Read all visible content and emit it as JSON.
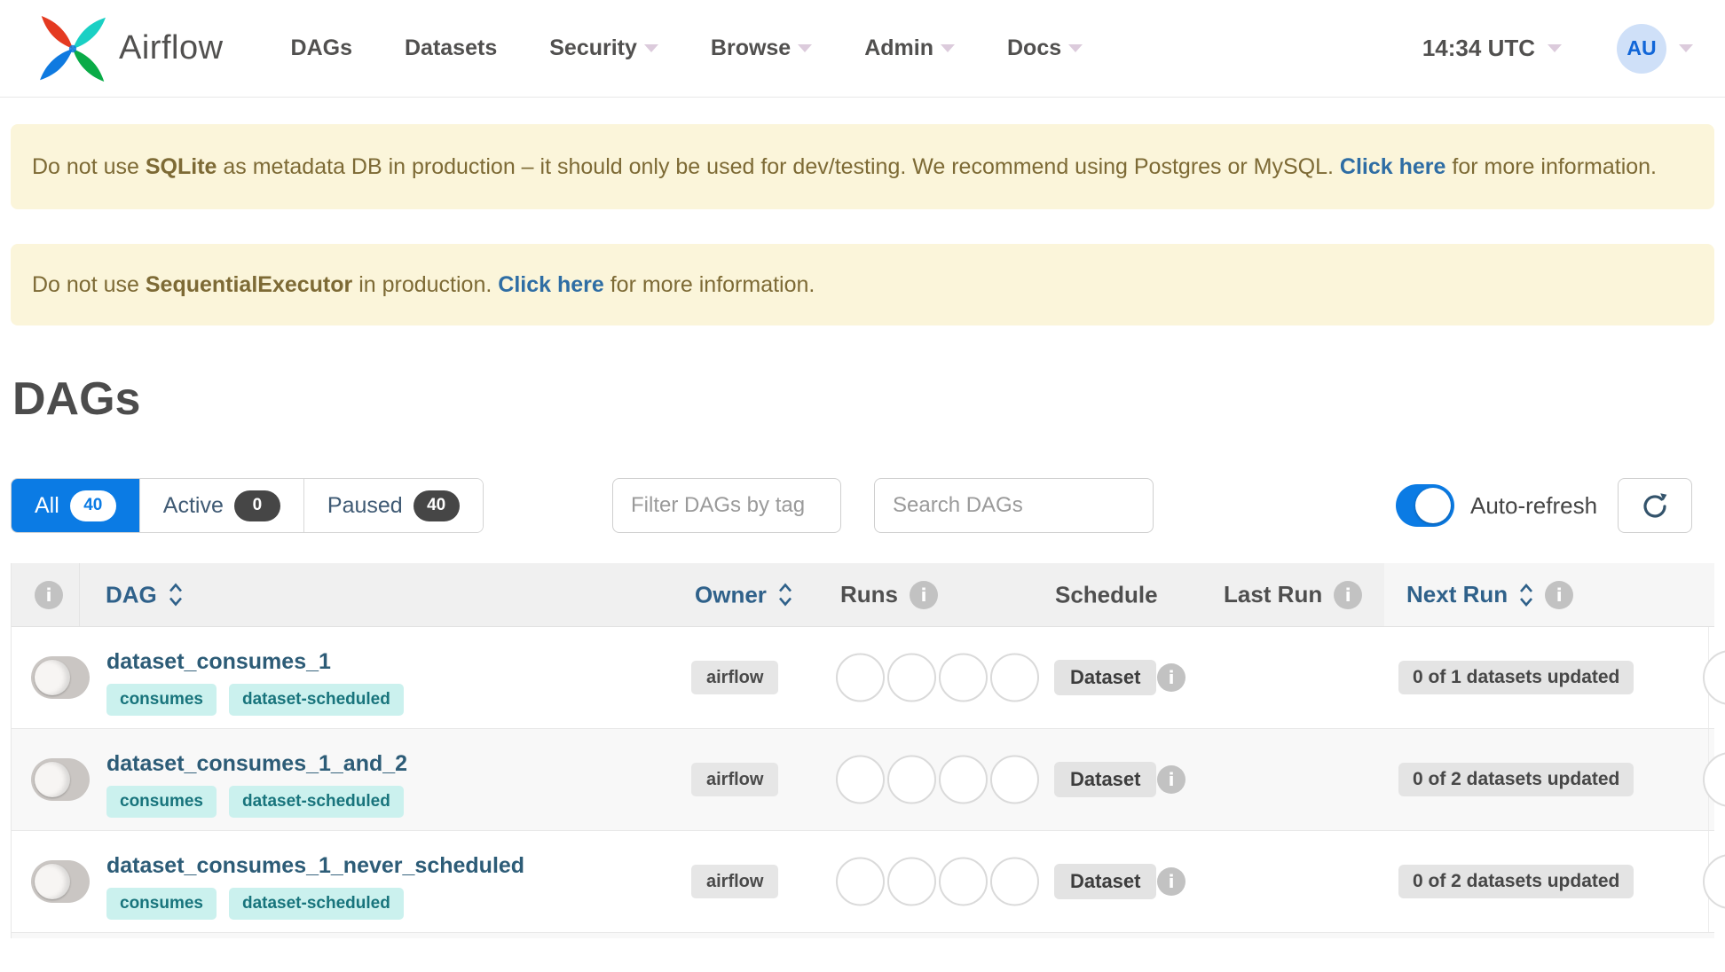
{
  "navbar": {
    "brand": "Airflow",
    "items": [
      {
        "label": "DAGs"
      },
      {
        "label": "Datasets"
      },
      {
        "label": "Security"
      },
      {
        "label": "Browse"
      },
      {
        "label": "Admin"
      },
      {
        "label": "Docs"
      }
    ],
    "clock": "14:34 UTC",
    "avatar": "AU"
  },
  "banners": [
    {
      "prefix": "Do not use ",
      "strong": "SQLite",
      "middle": " as metadata DB in production – it should only be used for dev/testing. We recommend using Postgres or MySQL. ",
      "link": "Click here",
      "suffix": " for more information."
    },
    {
      "prefix": "Do not use ",
      "strong": "SequentialExecutor",
      "middle": " in production. ",
      "link": "Click here",
      "suffix": " for more information."
    }
  ],
  "page": {
    "title": "DAGs"
  },
  "controls": {
    "tabs": [
      {
        "label": "All",
        "count": "40",
        "active": true
      },
      {
        "label": "Active",
        "count": "0",
        "active": false
      },
      {
        "label": "Paused",
        "count": "40",
        "active": false
      }
    ],
    "filter_placeholder": "Filter DAGs by tag",
    "search_placeholder": "Search DAGs",
    "autorefresh_label": "Auto-refresh"
  },
  "table": {
    "columns": {
      "dag": "DAG",
      "owner": "Owner",
      "runs": "Runs",
      "schedule": "Schedule",
      "last_run": "Last Run",
      "next_run": "Next Run"
    },
    "rows": [
      {
        "name": "dataset_consumes_1",
        "tags": [
          "consumes",
          "dataset-scheduled"
        ],
        "owner": "airflow",
        "schedule": "Dataset",
        "last_run": "",
        "next_run": "0 of 1 datasets updated"
      },
      {
        "name": "dataset_consumes_1_and_2",
        "tags": [
          "consumes",
          "dataset-scheduled"
        ],
        "owner": "airflow",
        "schedule": "Dataset",
        "last_run": "",
        "next_run": "0 of 2 datasets updated"
      },
      {
        "name": "dataset_consumes_1_never_scheduled",
        "tags": [
          "consumes",
          "dataset-scheduled"
        ],
        "owner": "airflow",
        "schedule": "Dataset",
        "last_run": "",
        "next_run": "0 of 2 datasets updated"
      }
    ]
  },
  "colors": {
    "accent_blue": "#0b7be4",
    "banner_bg": "#fbf5da",
    "banner_text": "#7d6a35",
    "link_blue": "#2e6da4",
    "tag_bg": "#cbf1ee",
    "tag_text": "#18747c",
    "dag_link": "#2d5c77",
    "logo_red": "#e43a21",
    "logo_teal": "#1ad0c4",
    "logo_green": "#0aab47",
    "logo_blue": "#0f7ae0"
  }
}
